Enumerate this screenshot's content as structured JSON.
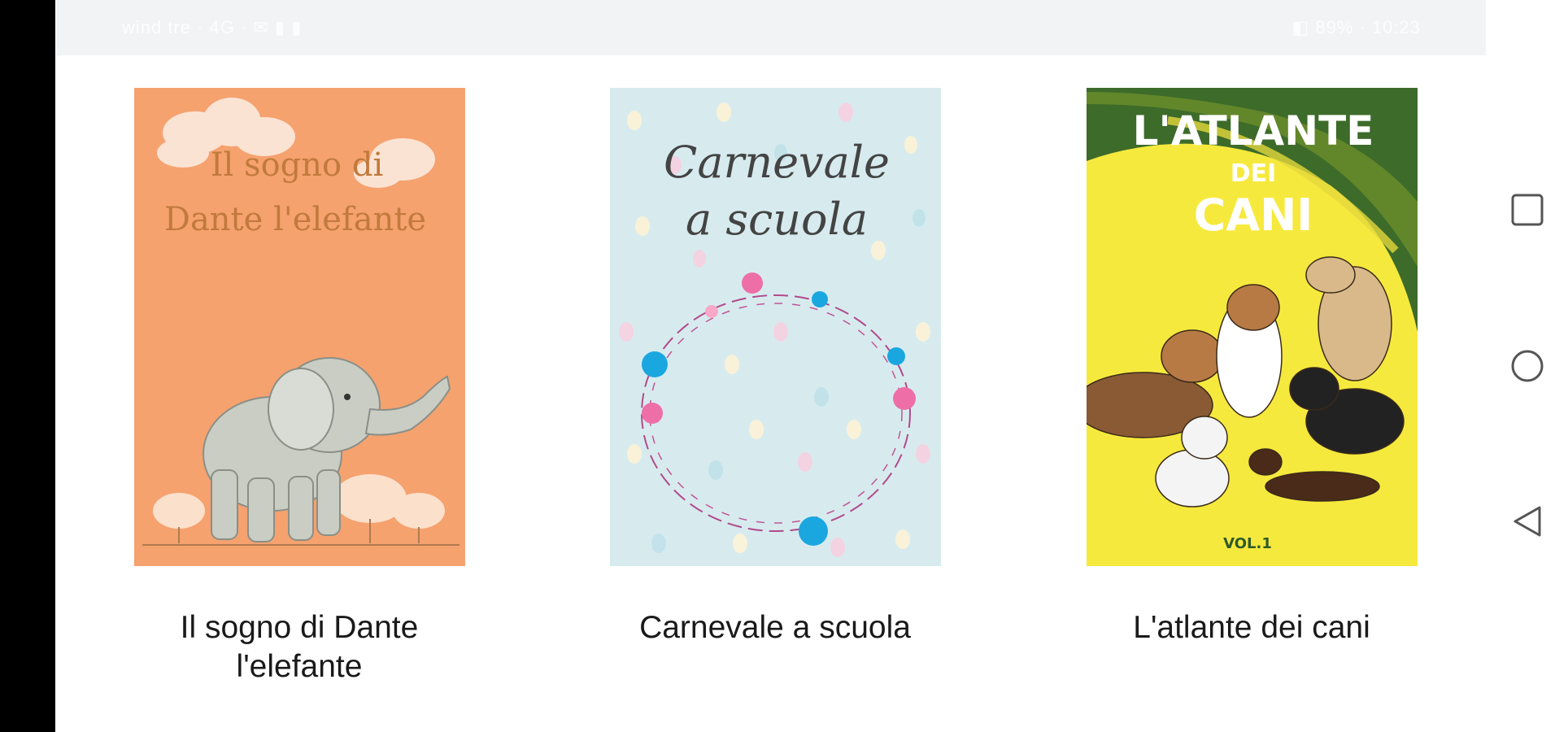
{
  "status_bar": {
    "left_text": "wind tre · 4G · ✉ ▮ ▮",
    "right_text": "◧ 89% · 10:23"
  },
  "books": [
    {
      "title": "Il sogno di Dante l'elefante",
      "cover_text_line1": "Il sogno di",
      "cover_text_line2": "Dante l'elefante",
      "cover_color": "#f5a26f"
    },
    {
      "title": "Carnevale a scuola",
      "cover_text_line1": "Carnevale",
      "cover_text_line2": "a scuola",
      "cover_color": "#d7ebef"
    },
    {
      "title": "L'atlante dei cani",
      "cover_text_line1": "L'ATLANTE",
      "cover_text_line2": "DEI",
      "cover_text_line3": "CANI",
      "cover_badge": "VOL.1",
      "cover_color": "#f6e93d"
    }
  ],
  "navigation": {
    "recents": "square-icon",
    "home": "circle-icon",
    "back": "triangle-back-icon"
  },
  "colors": {
    "background": "#ffffff",
    "status_bar": "#f1f3f5",
    "text": "#1a1a1a"
  }
}
